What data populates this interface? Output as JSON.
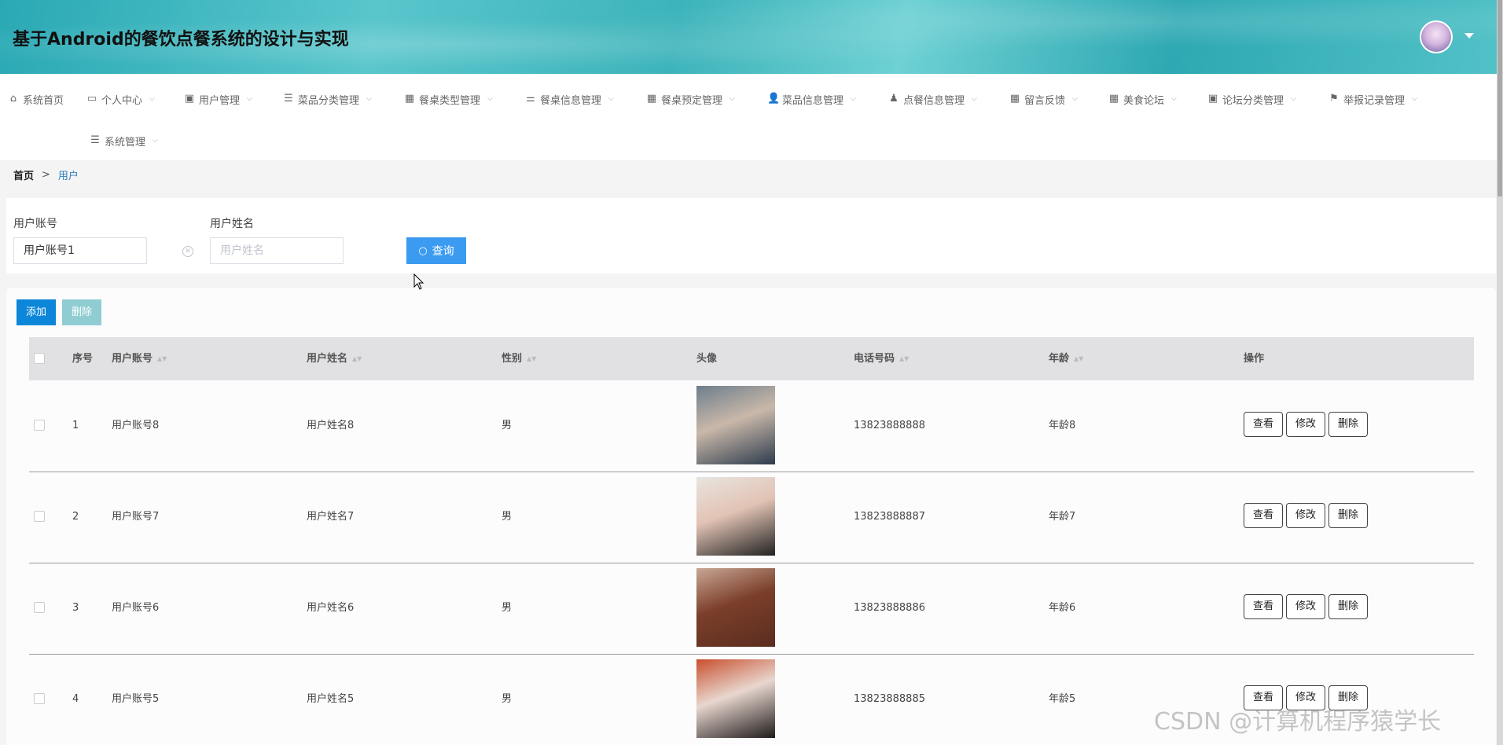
{
  "header": {
    "title": "基于Android的餐饮点餐系统的设计与实现"
  },
  "nav": {
    "items": [
      {
        "label": "系统首页",
        "icon": "home-icon",
        "glyph": "⌂",
        "has_dropdown": false
      },
      {
        "label": "个人中心",
        "icon": "id-card-icon",
        "glyph": "▭",
        "has_dropdown": true
      },
      {
        "label": "用户管理",
        "icon": "clipboard-icon",
        "glyph": "▣",
        "has_dropdown": true
      },
      {
        "label": "菜品分类管理",
        "icon": "list-icon",
        "glyph": "☰",
        "has_dropdown": true
      },
      {
        "label": "餐桌类型管理",
        "icon": "grid-icon",
        "glyph": "▦",
        "has_dropdown": true
      },
      {
        "label": "餐桌信息管理",
        "icon": "sliders-icon",
        "glyph": "⚌",
        "has_dropdown": true
      },
      {
        "label": "餐桌预定管理",
        "icon": "grid-icon",
        "glyph": "▦",
        "has_dropdown": true
      },
      {
        "label": "菜品信息管理",
        "icon": "user-icon",
        "glyph": "👤",
        "has_dropdown": true
      },
      {
        "label": "点餐信息管理",
        "icon": "person-icon",
        "glyph": "♟",
        "has_dropdown": true
      },
      {
        "label": "留言反馈",
        "icon": "grid-icon",
        "glyph": "▦",
        "has_dropdown": true
      },
      {
        "label": "美食论坛",
        "icon": "grid-icon",
        "glyph": "▦",
        "has_dropdown": true
      },
      {
        "label": "论坛分类管理",
        "icon": "clipboard-x-icon",
        "glyph": "▣",
        "has_dropdown": true
      },
      {
        "label": "举报记录管理",
        "icon": "flag-icon",
        "glyph": "⚑",
        "has_dropdown": true
      },
      {
        "label": "系统管理",
        "icon": "list-icon",
        "glyph": "☰",
        "has_dropdown": true
      }
    ],
    "chevron": "⌵"
  },
  "breadcrumb": {
    "home": "首页",
    "separator": ">",
    "current": "用户"
  },
  "search": {
    "account_label": "用户账号",
    "account_value": "用户账号1",
    "name_label": "用户姓名",
    "name_placeholder": "用户姓名",
    "clear_glyph": "✕",
    "query_label": "查询",
    "query_icon_glyph": "○"
  },
  "toolbar": {
    "add_label": "添加",
    "delete_label": "删除"
  },
  "table": {
    "columns": [
      "序号",
      "用户账号",
      "用户姓名",
      "性别",
      "头像",
      "电话号码",
      "年龄",
      "操作"
    ],
    "sort_glyph": "▲▼",
    "rows": [
      {
        "index": "1",
        "account": "用户账号8",
        "name": "用户姓名8",
        "gender": "男",
        "phone": "13823888888",
        "age": "年龄8",
        "photo_colors": [
          "#6d7e8c",
          "#c9b8a9",
          "#2d3b4d"
        ]
      },
      {
        "index": "2",
        "account": "用户账号7",
        "name": "用户姓名7",
        "gender": "男",
        "phone": "13823888887",
        "age": "年龄7",
        "photo_colors": [
          "#e8e4e0",
          "#e2c3b4",
          "#222222"
        ]
      },
      {
        "index": "3",
        "account": "用户账号6",
        "name": "用户姓名6",
        "gender": "男",
        "phone": "13823888886",
        "age": "年龄6",
        "photo_colors": [
          "#c9a796",
          "#7b3f2a",
          "#5a2c1f"
        ]
      },
      {
        "index": "4",
        "account": "用户账号5",
        "name": "用户姓名5",
        "gender": "男",
        "phone": "13823888885",
        "age": "年龄5",
        "photo_colors": [
          "#c94f2e",
          "#e8d7cf",
          "#1f1a1a"
        ]
      }
    ],
    "actions": {
      "view": "查看",
      "edit": "修改",
      "delete": "删除"
    }
  },
  "watermark": "CSDN @计算机程序猿学长",
  "colors": {
    "header_teal": "#3cb3ba",
    "primary_blue": "#3a9bf0",
    "add_button": "#0b86d8",
    "delete_button_disabled": "#8fcdd2",
    "breadcrumb_active": "#2f7fb8"
  }
}
